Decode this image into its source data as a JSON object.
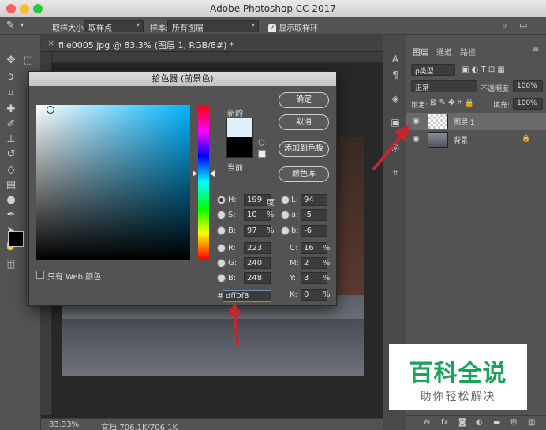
{
  "window": {
    "title": "Adobe Photoshop CC 2017"
  },
  "options_bar": {
    "sample_size_label": "取样大小:",
    "sample_size_value": "取样点",
    "sample_label": "样本:",
    "sample_value": "所有图层",
    "show_ring_label": "显示取样环"
  },
  "document": {
    "tab_title": "file0005.jpg @ 83.3% (图层 1, RGB/8#) *",
    "zoom": "83.33%",
    "doc_size": "文档:706.1K/706.1K"
  },
  "layers_panel": {
    "tabs": [
      "图层",
      "通道",
      "路径"
    ],
    "filter": "ρ类型",
    "blend_mode": "正常",
    "opacity_label": "不透明度:",
    "opacity": "100%",
    "lock_label": "锁定:",
    "fill_label": "填充:",
    "fill": "100%",
    "layers": [
      {
        "name": "图层 1"
      },
      {
        "name": "背景"
      }
    ]
  },
  "color_picker": {
    "title": "拾色器 (前景色)",
    "new_label": "新的",
    "current_label": "当前",
    "buttons": {
      "ok": "确定",
      "cancel": "取消",
      "add_swatch": "添加到色板",
      "libraries": "颜色库"
    },
    "web_only_label": "只有 Web 颜色",
    "hsb": {
      "h": "199",
      "h_unit": "度",
      "s": "10",
      "s_unit": "%",
      "b": "97",
      "b_unit": "%"
    },
    "rgb": {
      "r": "223",
      "g": "240",
      "b": "248"
    },
    "lab": {
      "l": "94",
      "a": "-5",
      "b": "-6"
    },
    "cmyk": {
      "c": "16",
      "m": "2",
      "y": "3",
      "k": "0",
      "unit": "%"
    },
    "hex_label": "#",
    "hex": "dff0f8",
    "labels": {
      "h": "H:",
      "s": "S:",
      "b": "B:",
      "r": "R:",
      "g": "G:",
      "bb": "B:",
      "l": "L:",
      "a": "a:",
      "lb": "b:",
      "c": "C:",
      "m": "M:",
      "y": "Y:",
      "k": "K:"
    },
    "new_color": "#dff0f8",
    "current_color": "#000000"
  },
  "watermark": {
    "title": "百科全说",
    "subtitle": "助你轻松解决"
  },
  "colors": {
    "accent_arrow": "#c4262e",
    "brand_green": "#1aa35b"
  }
}
